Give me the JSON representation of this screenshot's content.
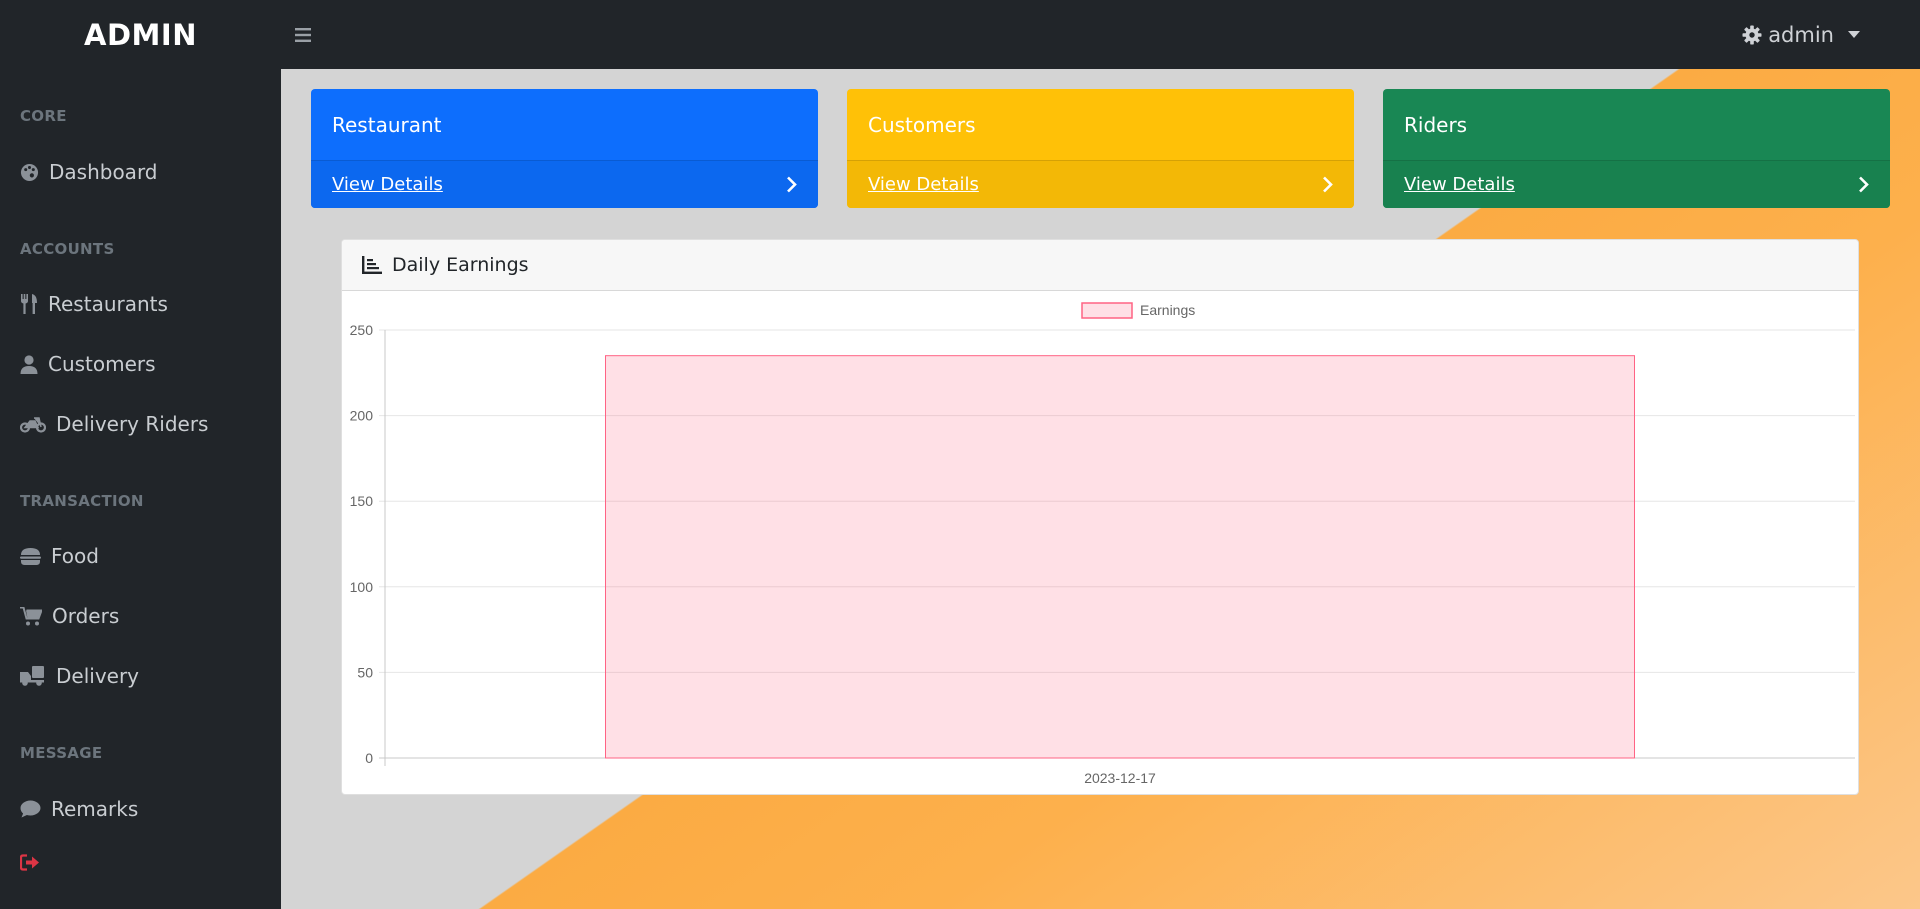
{
  "topnav": {
    "brand": "ADMIN",
    "menu_icon": "bars-icon",
    "user_label": "admin",
    "user_icon": "gear-icon"
  },
  "sidebar": {
    "sections": [
      {
        "heading": "CORE",
        "items": [
          {
            "label": "Dashboard",
            "icon": "palette-icon"
          }
        ]
      },
      {
        "heading": "ACCOUNTS",
        "items": [
          {
            "label": "Restaurants",
            "icon": "utensils-icon"
          },
          {
            "label": "Customers",
            "icon": "user-icon"
          },
          {
            "label": "Delivery Riders",
            "icon": "motorcycle-icon"
          }
        ]
      },
      {
        "heading": "TRANSACTION",
        "items": [
          {
            "label": "Food",
            "icon": "burger-icon"
          },
          {
            "label": "Orders",
            "icon": "cart-icon"
          },
          {
            "label": "Delivery",
            "icon": "truck-icon"
          }
        ]
      },
      {
        "heading": "MESSAGE",
        "items": [
          {
            "label": "Remarks",
            "icon": "comment-icon"
          }
        ]
      }
    ],
    "logout_icon": "sign-out-icon",
    "logout_color": "#dc3545"
  },
  "cards": [
    {
      "title": "Restaurant",
      "link": "View Details",
      "color": "#0d6efd"
    },
    {
      "title": "Customers",
      "link": "View Details",
      "color": "#ffc107"
    },
    {
      "title": "Riders",
      "link": "View Details",
      "color": "#198754"
    }
  ],
  "chart_card": {
    "title": "Daily Earnings",
    "icon": "chart-area-icon"
  },
  "chart_data": {
    "type": "bar",
    "categories": [
      "2023-12-17"
    ],
    "series": [
      {
        "name": "Earnings",
        "values": [
          235
        ],
        "color": "#ff6384"
      }
    ],
    "ylim": [
      0,
      250
    ],
    "yticks": [
      0,
      50,
      100,
      150,
      200,
      250
    ],
    "grid": true,
    "legend": "top-center"
  }
}
